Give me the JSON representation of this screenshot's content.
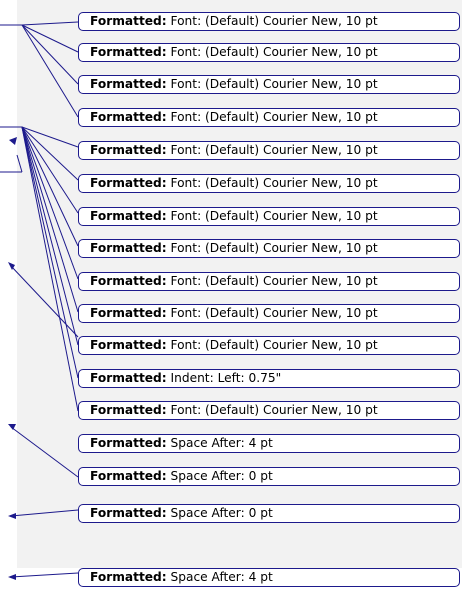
{
  "balloons": [
    {
      "label": "Formatted:",
      "text": " Font: (Default) Courier New, 10 pt"
    },
    {
      "label": "Formatted:",
      "text": " Font: (Default) Courier New, 10 pt"
    },
    {
      "label": "Formatted:",
      "text": " Font: (Default) Courier New, 10 pt"
    },
    {
      "label": "Formatted:",
      "text": " Font: (Default) Courier New, 10 pt"
    },
    {
      "label": "Formatted:",
      "text": " Font: (Default) Courier New, 10 pt"
    },
    {
      "label": "Formatted:",
      "text": " Font: (Default) Courier New, 10 pt"
    },
    {
      "label": "Formatted:",
      "text": " Font: (Default) Courier New, 10 pt"
    },
    {
      "label": "Formatted:",
      "text": " Font: (Default) Courier New, 10 pt"
    },
    {
      "label": "Formatted:",
      "text": " Font: (Default) Courier New, 10 pt"
    },
    {
      "label": "Formatted:",
      "text": " Font: (Default) Courier New, 10 pt"
    },
    {
      "label": "Formatted:",
      "text": " Font: (Default) Courier New, 10 pt"
    },
    {
      "label": "Formatted:",
      "text": " Indent: Left:  0.75\""
    },
    {
      "label": "Formatted:",
      "text": " Font: (Default) Courier New, 10 pt"
    },
    {
      "label": "Formatted:",
      "text": " Space After:  4 pt"
    },
    {
      "label": "Formatted:",
      "text": " Space After:  0 pt"
    },
    {
      "label": "Formatted:",
      "text": " Space After:  0 pt"
    },
    {
      "label": "Formatted:",
      "text": " Space After:  4 pt"
    }
  ],
  "colors": {
    "leader_line": "#1d1a8c",
    "balloon_border": "#1d1a8c",
    "margin_pane": "#f2f2f2"
  }
}
